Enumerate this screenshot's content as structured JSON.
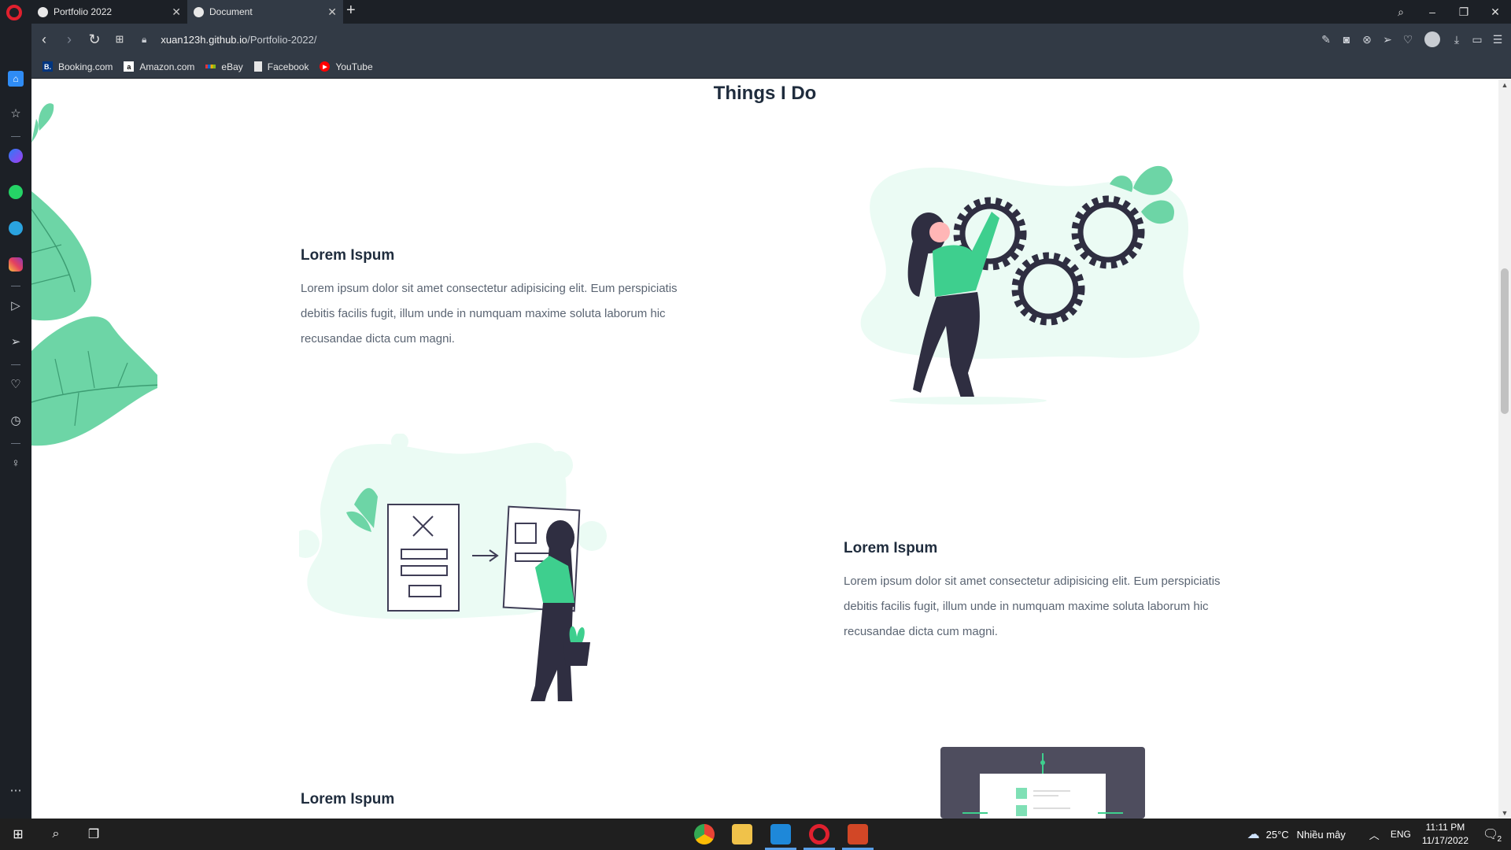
{
  "browser": {
    "tabs": [
      {
        "title": "Portfolio 2022",
        "active": false
      },
      {
        "title": "Document",
        "active": true
      }
    ],
    "new_tab": "+",
    "url": {
      "host": "xuan123h.github.io",
      "path": "/Portfolio-2022/"
    },
    "bookmarks": [
      {
        "label": "Booking.com",
        "icon": "booking-icon",
        "color": "#003580",
        "glyph": "B."
      },
      {
        "label": "Amazon.com",
        "icon": "amazon-icon",
        "color": "#ffffff",
        "glyph": "a"
      },
      {
        "label": "eBay",
        "icon": "ebay-icon",
        "color": "#e53238",
        "glyph": ""
      },
      {
        "label": "Facebook",
        "icon": "page-icon",
        "color": "#ffffff",
        "glyph": ""
      },
      {
        "label": "YouTube",
        "icon": "youtube-icon",
        "color": "#ff0000",
        "glyph": "▶"
      }
    ]
  },
  "page": {
    "section_title": "Things I Do",
    "items": [
      {
        "title": "Lorem Ispum",
        "text": "Lorem ipsum dolor sit amet consectetur adipisicing elit. Eum perspiciatis debitis facilis fugit, illum unde in numquam maxime soluta laborum hic recusandae dicta cum magni."
      },
      {
        "title": "Lorem Ispum",
        "text": "Lorem ipsum dolor sit amet consectetur adipisicing elit. Eum perspiciatis debitis facilis fugit, illum unde in numquam maxime soluta laborum hic recusandae dicta cum magni."
      },
      {
        "title": "Lorem Ispum"
      }
    ],
    "accent_color": "#3ecf8e",
    "accent_light": "#ebfbf4",
    "dark_color": "#2f2e41"
  },
  "taskbar": {
    "weather_temp": "25°C",
    "weather_desc": "Nhiều mây",
    "language": "ENG",
    "time": "11:11 PM",
    "date": "11/17/2022",
    "notifications": "2",
    "apps": [
      "chrome-icon",
      "file-explorer-icon",
      "vscode-icon",
      "opera-icon",
      "powerpoint-icon"
    ]
  }
}
